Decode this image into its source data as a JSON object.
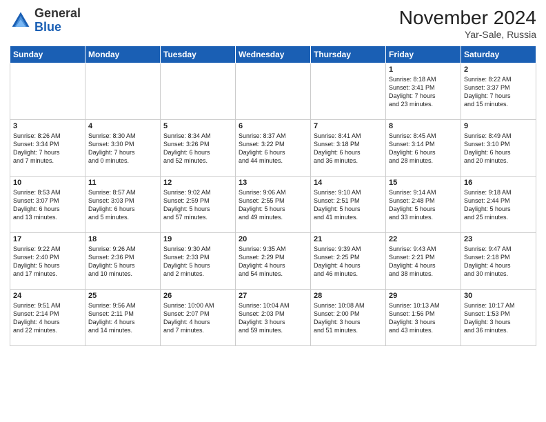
{
  "header": {
    "logo_general": "General",
    "logo_blue": "Blue",
    "month_title": "November 2024",
    "location": "Yar-Sale, Russia"
  },
  "days_of_week": [
    "Sunday",
    "Monday",
    "Tuesday",
    "Wednesday",
    "Thursday",
    "Friday",
    "Saturday"
  ],
  "weeks": [
    [
      {
        "day": "",
        "info": ""
      },
      {
        "day": "",
        "info": ""
      },
      {
        "day": "",
        "info": ""
      },
      {
        "day": "",
        "info": ""
      },
      {
        "day": "",
        "info": ""
      },
      {
        "day": "1",
        "info": "Sunrise: 8:18 AM\nSunset: 3:41 PM\nDaylight: 7 hours\nand 23 minutes."
      },
      {
        "day": "2",
        "info": "Sunrise: 8:22 AM\nSunset: 3:37 PM\nDaylight: 7 hours\nand 15 minutes."
      }
    ],
    [
      {
        "day": "3",
        "info": "Sunrise: 8:26 AM\nSunset: 3:34 PM\nDaylight: 7 hours\nand 7 minutes."
      },
      {
        "day": "4",
        "info": "Sunrise: 8:30 AM\nSunset: 3:30 PM\nDaylight: 7 hours\nand 0 minutes."
      },
      {
        "day": "5",
        "info": "Sunrise: 8:34 AM\nSunset: 3:26 PM\nDaylight: 6 hours\nand 52 minutes."
      },
      {
        "day": "6",
        "info": "Sunrise: 8:37 AM\nSunset: 3:22 PM\nDaylight: 6 hours\nand 44 minutes."
      },
      {
        "day": "7",
        "info": "Sunrise: 8:41 AM\nSunset: 3:18 PM\nDaylight: 6 hours\nand 36 minutes."
      },
      {
        "day": "8",
        "info": "Sunrise: 8:45 AM\nSunset: 3:14 PM\nDaylight: 6 hours\nand 28 minutes."
      },
      {
        "day": "9",
        "info": "Sunrise: 8:49 AM\nSunset: 3:10 PM\nDaylight: 6 hours\nand 20 minutes."
      }
    ],
    [
      {
        "day": "10",
        "info": "Sunrise: 8:53 AM\nSunset: 3:07 PM\nDaylight: 6 hours\nand 13 minutes."
      },
      {
        "day": "11",
        "info": "Sunrise: 8:57 AM\nSunset: 3:03 PM\nDaylight: 6 hours\nand 5 minutes."
      },
      {
        "day": "12",
        "info": "Sunrise: 9:02 AM\nSunset: 2:59 PM\nDaylight: 5 hours\nand 57 minutes."
      },
      {
        "day": "13",
        "info": "Sunrise: 9:06 AM\nSunset: 2:55 PM\nDaylight: 5 hours\nand 49 minutes."
      },
      {
        "day": "14",
        "info": "Sunrise: 9:10 AM\nSunset: 2:51 PM\nDaylight: 5 hours\nand 41 minutes."
      },
      {
        "day": "15",
        "info": "Sunrise: 9:14 AM\nSunset: 2:48 PM\nDaylight: 5 hours\nand 33 minutes."
      },
      {
        "day": "16",
        "info": "Sunrise: 9:18 AM\nSunset: 2:44 PM\nDaylight: 5 hours\nand 25 minutes."
      }
    ],
    [
      {
        "day": "17",
        "info": "Sunrise: 9:22 AM\nSunset: 2:40 PM\nDaylight: 5 hours\nand 17 minutes."
      },
      {
        "day": "18",
        "info": "Sunrise: 9:26 AM\nSunset: 2:36 PM\nDaylight: 5 hours\nand 10 minutes."
      },
      {
        "day": "19",
        "info": "Sunrise: 9:30 AM\nSunset: 2:33 PM\nDaylight: 5 hours\nand 2 minutes."
      },
      {
        "day": "20",
        "info": "Sunrise: 9:35 AM\nSunset: 2:29 PM\nDaylight: 4 hours\nand 54 minutes."
      },
      {
        "day": "21",
        "info": "Sunrise: 9:39 AM\nSunset: 2:25 PM\nDaylight: 4 hours\nand 46 minutes."
      },
      {
        "day": "22",
        "info": "Sunrise: 9:43 AM\nSunset: 2:21 PM\nDaylight: 4 hours\nand 38 minutes."
      },
      {
        "day": "23",
        "info": "Sunrise: 9:47 AM\nSunset: 2:18 PM\nDaylight: 4 hours\nand 30 minutes."
      }
    ],
    [
      {
        "day": "24",
        "info": "Sunrise: 9:51 AM\nSunset: 2:14 PM\nDaylight: 4 hours\nand 22 minutes."
      },
      {
        "day": "25",
        "info": "Sunrise: 9:56 AM\nSunset: 2:11 PM\nDaylight: 4 hours\nand 14 minutes."
      },
      {
        "day": "26",
        "info": "Sunrise: 10:00 AM\nSunset: 2:07 PM\nDaylight: 4 hours\nand 7 minutes."
      },
      {
        "day": "27",
        "info": "Sunrise: 10:04 AM\nSunset: 2:03 PM\nDaylight: 3 hours\nand 59 minutes."
      },
      {
        "day": "28",
        "info": "Sunrise: 10:08 AM\nSunset: 2:00 PM\nDaylight: 3 hours\nand 51 minutes."
      },
      {
        "day": "29",
        "info": "Sunrise: 10:13 AM\nSunset: 1:56 PM\nDaylight: 3 hours\nand 43 minutes."
      },
      {
        "day": "30",
        "info": "Sunrise: 10:17 AM\nSunset: 1:53 PM\nDaylight: 3 hours\nand 36 minutes."
      }
    ]
  ]
}
